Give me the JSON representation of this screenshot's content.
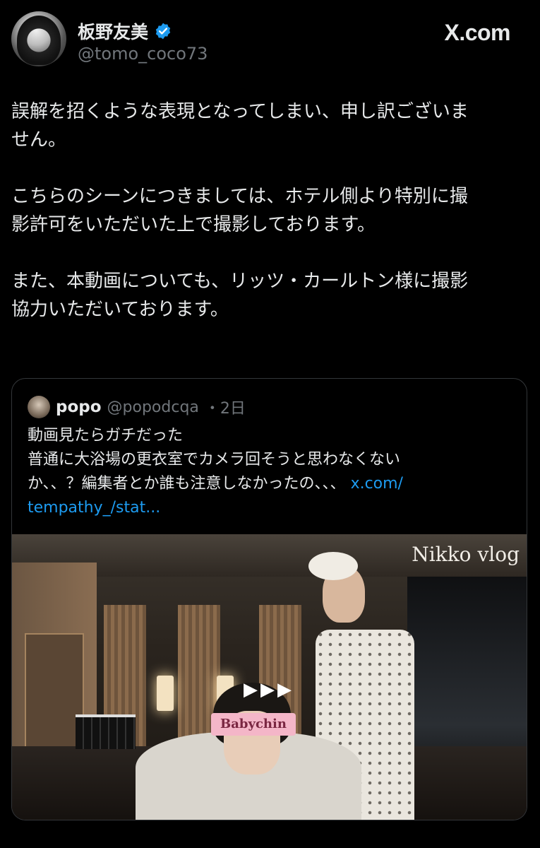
{
  "header": {
    "display_name": "板野友美",
    "handle": "@tomo_coco73",
    "brand": "X.com"
  },
  "tweet": {
    "paragraphs": [
      "誤解を招くような表現となってしまい、申し訳ございま\nせん。",
      "こちらのシーンにつきましては、ホテル側より特別に撮\n影許可をいただいた上で撮影しております。",
      "また、本動画についても、リッツ・カールトン様に撮影\n協力いただいております。"
    ]
  },
  "quote": {
    "name": "popo",
    "handle": "@popodcqa",
    "time": "・2日",
    "text": "動画見たらガチだった\n普通に大浴場の更衣室でカメラ回そうと思わなくない\nか、、？編集者とか誰も注意しなかったの、、、 ",
    "link_part1": "x.com/",
    "link_part2": "tempathy_/stat...",
    "video": {
      "overlay_title": "Nikko vlog",
      "sticker": "Babychin",
      "play_glyph": "▶▶▶"
    }
  },
  "colors": {
    "background": "#000000",
    "text": "#e7e9ea",
    "secondary": "#71767b",
    "link": "#1d9bf0",
    "verified": "#1d9bf0"
  },
  "icons": [
    "avatar",
    "verified-badge-icon",
    "x-logo-icon",
    "play-icon"
  ]
}
